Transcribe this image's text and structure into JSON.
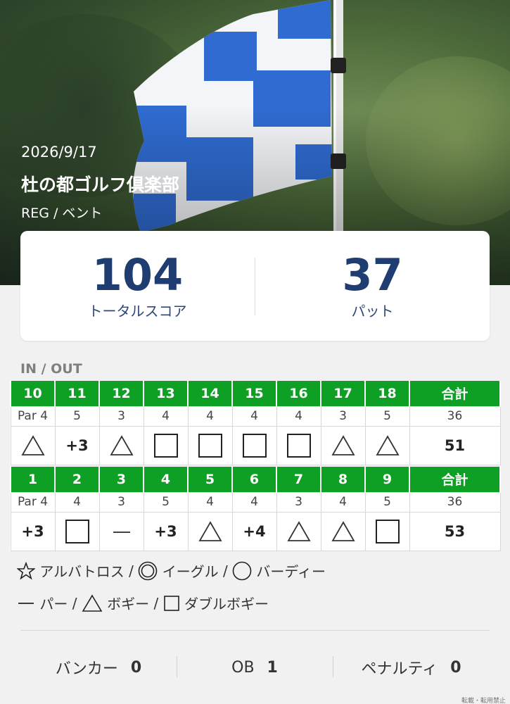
{
  "round": {
    "date": "2026/9/17",
    "club": "杜の都ゴルフ倶楽部",
    "tee_green": "REG  / ベント"
  },
  "summary": {
    "total_score": "104",
    "total_score_label": "トータルスコア",
    "putts": "37",
    "putts_label": "パット"
  },
  "scorecard": {
    "section_label": "IN / OUT",
    "in": {
      "holes": [
        "10",
        "11",
        "12",
        "13",
        "14",
        "15",
        "16",
        "17",
        "18"
      ],
      "total_label": "合計",
      "pars": [
        "Par 4",
        "5",
        "3",
        "4",
        "4",
        "4",
        "4",
        "3",
        "5"
      ],
      "par_total": "36",
      "results": [
        "triangle",
        "+3",
        "triangle",
        "square",
        "square",
        "square",
        "square",
        "triangle",
        "triangle"
      ],
      "score_total": "51"
    },
    "out": {
      "holes": [
        "1",
        "2",
        "3",
        "4",
        "5",
        "6",
        "7",
        "8",
        "9"
      ],
      "total_label": "合計",
      "pars": [
        "Par 4",
        "4",
        "3",
        "5",
        "4",
        "4",
        "3",
        "4",
        "5"
      ],
      "par_total": "36",
      "results": [
        "+3",
        "square",
        "dash",
        "+3",
        "triangle",
        "+4",
        "triangle",
        "triangle",
        "square"
      ],
      "score_total": "53"
    }
  },
  "legend": {
    "albatross": "アルバトロス",
    "eagle": "イーグル",
    "birdie": "バーディー",
    "par": "パー",
    "bogey": "ボギー",
    "double_bogey": "ダブルボギー",
    "separator": "/"
  },
  "stats": {
    "bunker_label": "バンカー",
    "bunker": "0",
    "ob_label": "OB",
    "ob": "1",
    "penalty_label": "ペナルティ",
    "penalty": "0"
  },
  "watermark": "転載・転用禁止",
  "colors": {
    "hole_header": "#0ea024",
    "score_number": "#1f3d70",
    "flag_blue": "#2f6bd1"
  }
}
